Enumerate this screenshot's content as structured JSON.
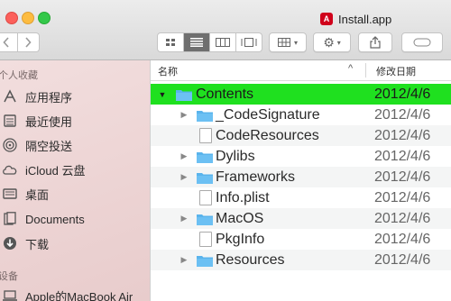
{
  "window": {
    "title": "Install.app",
    "app_icon_label": "A"
  },
  "toolbar": {
    "back_icon": "chevron-left-icon",
    "forward_icon": "chevron-right-icon"
  },
  "sidebar": {
    "favorites_header": "个人收藏",
    "devices_header": "设备",
    "items": [
      {
        "label": "应用程序",
        "icon": "applications-icon"
      },
      {
        "label": "最近使用",
        "icon": "recents-icon"
      },
      {
        "label": "隔空投送",
        "icon": "airdrop-icon"
      },
      {
        "label": "iCloud 云盘",
        "icon": "icloud-icon"
      },
      {
        "label": "桌面",
        "icon": "desktop-icon"
      },
      {
        "label": "Documents",
        "icon": "documents-icon"
      },
      {
        "label": "下载",
        "icon": "downloads-icon"
      }
    ],
    "devices": [
      {
        "label": "Apple的MacBook Air",
        "icon": "laptop-icon"
      }
    ]
  },
  "list": {
    "columns": {
      "name": "名称",
      "date": "修改日期"
    },
    "rows": [
      {
        "name": "Contents",
        "date": "2012/4/6",
        "type": "folder",
        "expanded": true,
        "selected": true
      },
      {
        "name": "_CodeSignature",
        "date": "2012/4/6",
        "type": "folder",
        "expanded": false
      },
      {
        "name": "CodeResources",
        "date": "2012/4/6",
        "type": "file"
      },
      {
        "name": "Dylibs",
        "date": "2012/4/6",
        "type": "folder",
        "expanded": false
      },
      {
        "name": "Frameworks",
        "date": "2012/4/6",
        "type": "folder",
        "expanded": false
      },
      {
        "name": "Info.plist",
        "date": "2012/4/6",
        "type": "file"
      },
      {
        "name": "MacOS",
        "date": "2012/4/6",
        "type": "folder",
        "expanded": false
      },
      {
        "name": "PkgInfo",
        "date": "2012/4/6",
        "type": "file"
      },
      {
        "name": "Resources",
        "date": "2012/4/6",
        "type": "folder",
        "expanded": false
      }
    ]
  },
  "colors": {
    "selection": "#1fe01f",
    "folder": "#5ab4ec"
  }
}
